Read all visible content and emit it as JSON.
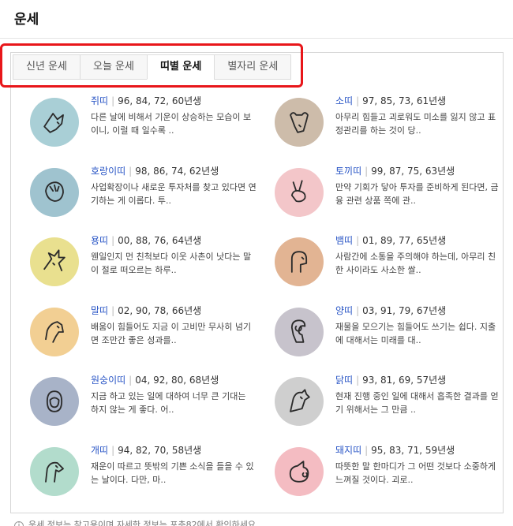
{
  "header": {
    "title": "운세"
  },
  "tabs": [
    {
      "label": "신년 운세"
    },
    {
      "label": "오늘 운세"
    },
    {
      "label": "띠별 운세"
    },
    {
      "label": "별자리 운세"
    }
  ],
  "active_tab": "띠별 운세",
  "zodiac": [
    {
      "name": "쥐띠",
      "years": "96, 84, 72, 60년생",
      "desc": "다른 날에 비해서 기운이 상승하는 모습이 보이니, 이럴 때 일수록 ..",
      "color": "#a9cfd6",
      "icon": "rat-icon"
    },
    {
      "name": "소띠",
      "years": "97, 85, 73, 61년생",
      "desc": "아무리 힘들고 괴로워도 미소를 잃지 않고 표정관리를 하는 것이 당..",
      "color": "#cdbcaa",
      "icon": "ox-icon"
    },
    {
      "name": "호랑이띠",
      "years": "98, 86, 74, 62년생",
      "desc": "사업확장이나 새로운 투자처를 찾고 있다면 연기하는 게 이롭다. 투..",
      "color": "#9fc3cf",
      "icon": "tiger-icon"
    },
    {
      "name": "토끼띠",
      "years": "99, 87, 75, 63년생",
      "desc": "만약 기회가 닿아 투자를 준비하게 된다면, 금융 관련 상품 쪽에 관..",
      "color": "#f3c6c9",
      "icon": "rabbit-icon"
    },
    {
      "name": "용띠",
      "years": "00, 88, 76, 64년생",
      "desc": "웬일인지 먼 친척보다 이웃 사촌이 낫다는 말이 절로 떠오르는 하루..",
      "color": "#e9e08f",
      "icon": "dragon-icon"
    },
    {
      "name": "뱀띠",
      "years": "01, 89, 77, 65년생",
      "desc": "사람간에 소통을 주의해야 하는데, 아무리 친한 사이라도 사소한 쌀..",
      "color": "#e2b493",
      "icon": "snake-icon"
    },
    {
      "name": "말띠",
      "years": "02, 90, 78, 66년생",
      "desc": "배움이 힘들어도 지금 이 고비만 무사히 넘기면 조만간 좋은 성과를..",
      "color": "#f2cf93",
      "icon": "horse-icon"
    },
    {
      "name": "양띠",
      "years": "03, 91, 79, 67년생",
      "desc": "재물을 모으기는 힘들어도 쓰기는 쉽다. 지출에 대해서는 미래를 대..",
      "color": "#c7c3cc",
      "icon": "sheep-icon"
    },
    {
      "name": "원숭이띠",
      "years": "04, 92, 80, 68년생",
      "desc": "지금 하고 있는 일에 대하여 너무 큰 기대는 하지 않는 게 좋다. 어..",
      "color": "#a8b3c8",
      "icon": "monkey-icon"
    },
    {
      "name": "닭띠",
      "years": "93, 81, 69, 57년생",
      "desc": "현재 진행 중인 일에 대해서 흡족한 결과를 얻기 위해서는 그 만큼 ..",
      "color": "#cfcfcf",
      "icon": "rooster-icon"
    },
    {
      "name": "개띠",
      "years": "94, 82, 70, 58년생",
      "desc": "재운이 따르고 뜻밖의 기쁜 소식을 들을 수 있는 날이다. 다만, 마..",
      "color": "#b2dccc",
      "icon": "dog-icon"
    },
    {
      "name": "돼지띠",
      "years": "95, 83, 71, 59년생",
      "desc": "따뜻한 말 한마디가 그 어떤 것보다 소중하게 느껴질 것이다. 괴로..",
      "color": "#f4bcc2",
      "icon": "pig-icon"
    }
  ],
  "footer": {
    "text": "운세 정보는 참고용이며 자세한 정보는 포춘82에서 확인하세요"
  }
}
